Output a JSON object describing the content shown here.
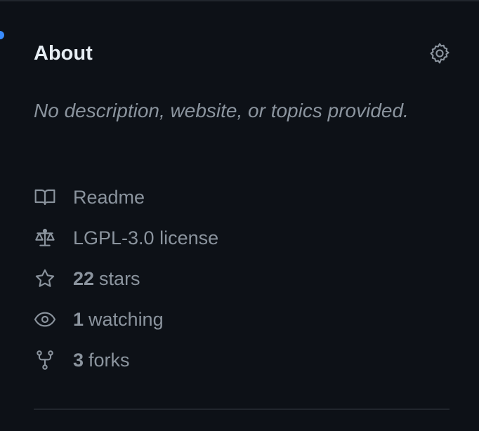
{
  "about": {
    "title": "About",
    "description": "No description, website, or topics provided."
  },
  "meta": {
    "readme": "Readme",
    "license": "LGPL-3.0 license",
    "stars_count": "22",
    "stars_label": "stars",
    "watching_count": "1",
    "watching_label": "watching",
    "forks_count": "3",
    "forks_label": "forks"
  },
  "icons": {
    "settings": "gear-icon",
    "readme": "book-icon",
    "license": "law-icon",
    "stars": "star-icon",
    "watching": "eye-icon",
    "forks": "fork-icon"
  },
  "colors": {
    "background": "#0d1117",
    "heading": "#e6edf3",
    "muted": "#8b949e",
    "border": "#21262d",
    "accent": "#388bfd"
  }
}
